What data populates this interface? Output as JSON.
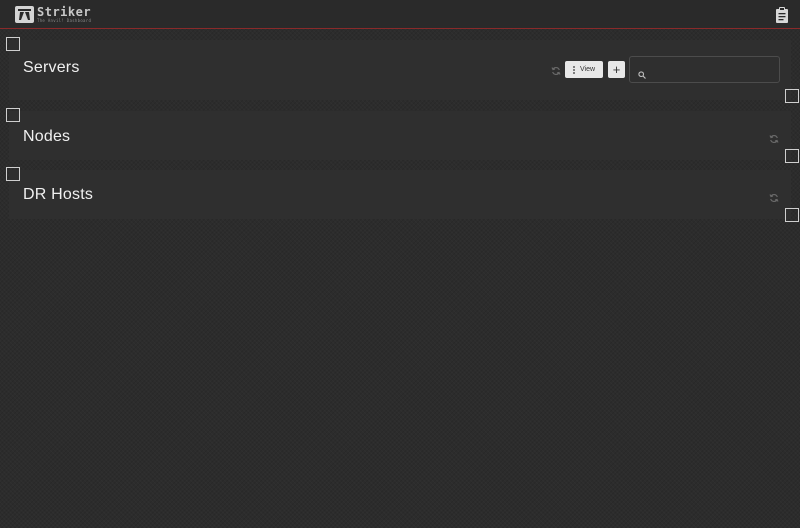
{
  "header": {
    "brand_name": "Striker",
    "brand_subtitle": "The Anvil! Dashboard",
    "logo_icon": "anvil-logo-icon",
    "right_icon": "clipboard-icon",
    "accent_color": "#8a2a2a"
  },
  "panels": {
    "servers": {
      "title": "Servers",
      "view_label": "View",
      "add_label": "+",
      "search_placeholder": "",
      "search_value": ""
    },
    "nodes": {
      "title": "Nodes"
    },
    "dr_hosts": {
      "title": "DR Hosts"
    }
  }
}
